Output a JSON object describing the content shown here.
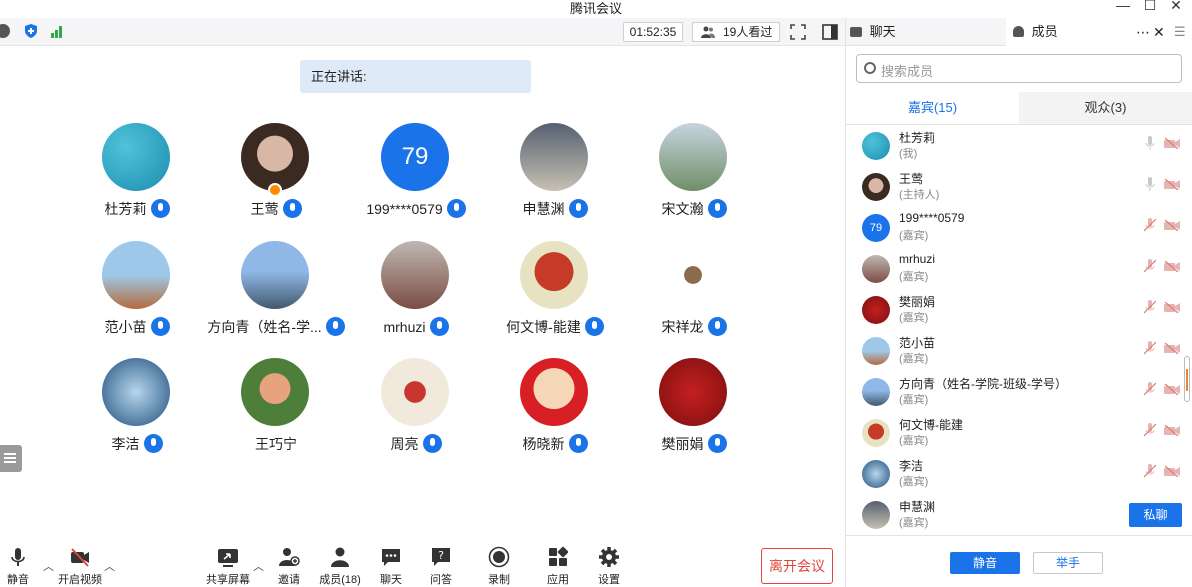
{
  "window": {
    "title": "腾讯会议"
  },
  "topbar": {
    "timer": "01:52:35",
    "viewers": "19人看过"
  },
  "speaking": {
    "label": "正在讲话:"
  },
  "tiles": [
    {
      "name": "杜芳莉",
      "avatar": "photo",
      "color1": "#4fc3d9",
      "color2": "#1c8db0"
    },
    {
      "name": "王莺",
      "avatar": "photo-host",
      "color1": "#3a2a22",
      "color2": "#d8b7a6"
    },
    {
      "name": "199****0579",
      "avatar": "number",
      "initials": "79"
    },
    {
      "name": "申慧渊",
      "avatar": "photo",
      "color1": "#556070",
      "color2": "#c7c1b2"
    },
    {
      "name": "宋文瀚",
      "avatar": "photo",
      "color1": "#6f8f67",
      "color2": "#c7d4e0"
    },
    {
      "name": "范小苗",
      "avatar": "photo",
      "color1": "#9ec8ea",
      "color2": "#b46a3c"
    },
    {
      "name": "方向青（姓名-学...",
      "avatar": "photo",
      "color1": "#8fb8e6",
      "color2": "#42586e"
    },
    {
      "name": "mrhuzi",
      "avatar": "photo",
      "color1": "#7b4d45",
      "color2": "#bfb8b2"
    },
    {
      "name": "何文博-能建",
      "avatar": "photo",
      "color1": "#e7e2c2",
      "color2": "#c63a28"
    },
    {
      "name": "宋祥龙",
      "avatar": "photo",
      "color1": "#ffffff",
      "color2": "#8c6a4b"
    },
    {
      "name": "李洁",
      "avatar": "photo",
      "color1": "#1e4f7a",
      "color2": "#b8d6ef"
    },
    {
      "name": "王巧宁",
      "avatar": "photo",
      "color1": "#4e7f3a",
      "color2": "#e7a37e"
    },
    {
      "name": "周亮",
      "avatar": "photo",
      "color1": "#f1e9dc",
      "color2": "#c8372f"
    },
    {
      "name": "杨晓新",
      "avatar": "photo",
      "color1": "#d81f26",
      "color2": "#f5d7b8"
    },
    {
      "name": "樊丽娟",
      "avatar": "photo",
      "color1": "#c61f1f",
      "color2": "#7a1010"
    }
  ],
  "toolbar": {
    "mute": "静音",
    "video": "开启视频",
    "share": "共享屏幕",
    "invite": "邀请",
    "members": "成员(18)",
    "chat": "聊天",
    "qa": "问答",
    "record": "录制",
    "apps": "应用",
    "settings": "设置",
    "leave": "离开会议"
  },
  "panel": {
    "tab_chat": "聊天",
    "tab_members": "成员",
    "search_placeholder": "搜索成员",
    "tab_guests": "嘉宾(15)",
    "tab_audience": "观众(3)",
    "members": [
      {
        "name": "杜芳莉",
        "role": "(我)",
        "color1": "#4fc3d9",
        "color2": "#1c8db0"
      },
      {
        "name": "王莺",
        "role": "(主持人)",
        "color1": "#3a2a22",
        "color2": "#d8b7a6"
      },
      {
        "name": "199****0579",
        "role": "(嘉宾)",
        "initials": "79"
      },
      {
        "name": "mrhuzi",
        "role": "(嘉宾)",
        "color1": "#7b4d45",
        "color2": "#bfb8b2"
      },
      {
        "name": "樊丽娟",
        "role": "(嘉宾)",
        "color1": "#c61f1f",
        "color2": "#7a1010"
      },
      {
        "name": "范小苗",
        "role": "(嘉宾)",
        "color1": "#9ec8ea",
        "color2": "#b46a3c"
      },
      {
        "name": "方向青（姓名-学院-班级-学号）",
        "role": "(嘉宾)",
        "color1": "#8fb8e6",
        "color2": "#42586e"
      },
      {
        "name": "何文博-能建",
        "role": "(嘉宾)",
        "color1": "#e7e2c2",
        "color2": "#c63a28"
      },
      {
        "name": "李洁",
        "role": "(嘉宾)",
        "color1": "#1e4f7a",
        "color2": "#b8d6ef"
      },
      {
        "name": "申慧渊",
        "role": "(嘉宾)",
        "color1": "#556070",
        "color2": "#c7c1b2"
      }
    ],
    "private_chat": "私聊",
    "mute_all": "静音",
    "raise_hand": "举手"
  },
  "colors": {
    "accent": "#1a73e8",
    "leave": "#e0463b"
  }
}
